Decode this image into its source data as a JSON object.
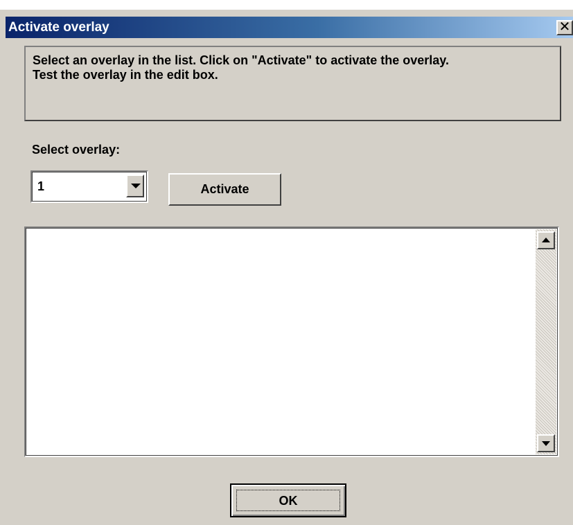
{
  "window": {
    "title": "Activate overlay",
    "close_glyph": "✕"
  },
  "info": {
    "line1": "Select an overlay in the list. Click on \"Activate\" to activate the overlay.",
    "line2": "Test the overlay in the edit box."
  },
  "overlay_select": {
    "label": "Select overlay:",
    "value": "1"
  },
  "buttons": {
    "activate": "Activate",
    "ok": "OK"
  },
  "edit_box": {
    "value": ""
  },
  "icons": {
    "close": "close-icon",
    "dropdown": "chevron-down-icon",
    "scroll_up": "scroll-up-icon",
    "scroll_down": "scroll-down-icon"
  },
  "colors": {
    "dialog_bg": "#d4d0c8",
    "title_start": "#0a246a",
    "title_end": "#a6caf0",
    "title_text": "#ffffff"
  }
}
